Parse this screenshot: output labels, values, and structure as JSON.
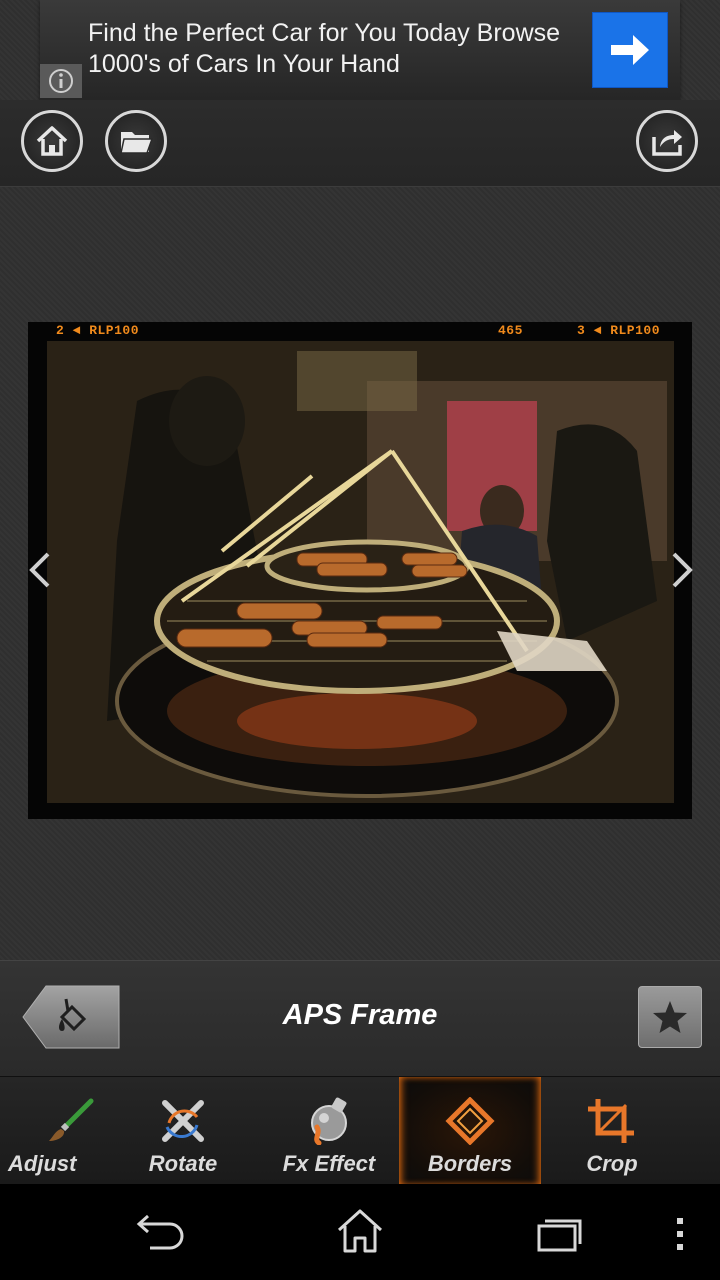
{
  "ad": {
    "text": "Find the Perfect Car for You Today Browse 1000's of Cars In Your Hand",
    "info_icon": "info-icon",
    "cta_icon": "arrow-right-icon",
    "cta_color": "#1a73e8"
  },
  "toolbar": {
    "home_icon": "home-icon",
    "open_icon": "folder-icon",
    "share_icon": "share-icon"
  },
  "photo": {
    "film_codes": [
      "2 ◄ RLP100",
      "465",
      "3 ◄ RLP100"
    ],
    "description_icon": "photo-preview"
  },
  "panel": {
    "frame_name": "APS Frame",
    "back_icon": "paint-bucket-icon",
    "favorite_icon": "star-icon"
  },
  "tabs": [
    {
      "label": "Adjust",
      "icon": "brush-icon",
      "selected": false
    },
    {
      "label": "Rotate",
      "icon": "rotate-icon",
      "selected": false
    },
    {
      "label": "Fx Effect",
      "icon": "fx-potion-icon",
      "selected": false
    },
    {
      "label": "Borders",
      "icon": "diamond-frame-icon",
      "selected": true
    },
    {
      "label": "Crop",
      "icon": "crop-icon",
      "selected": false
    }
  ],
  "system_nav": {
    "back_icon": "back-icon",
    "home_icon": "home-outline-icon",
    "recents_icon": "recents-icon",
    "menu_icon": "overflow-menu-icon"
  },
  "colors": {
    "accent": "#e8772a",
    "film_code": "#f08a1c"
  }
}
